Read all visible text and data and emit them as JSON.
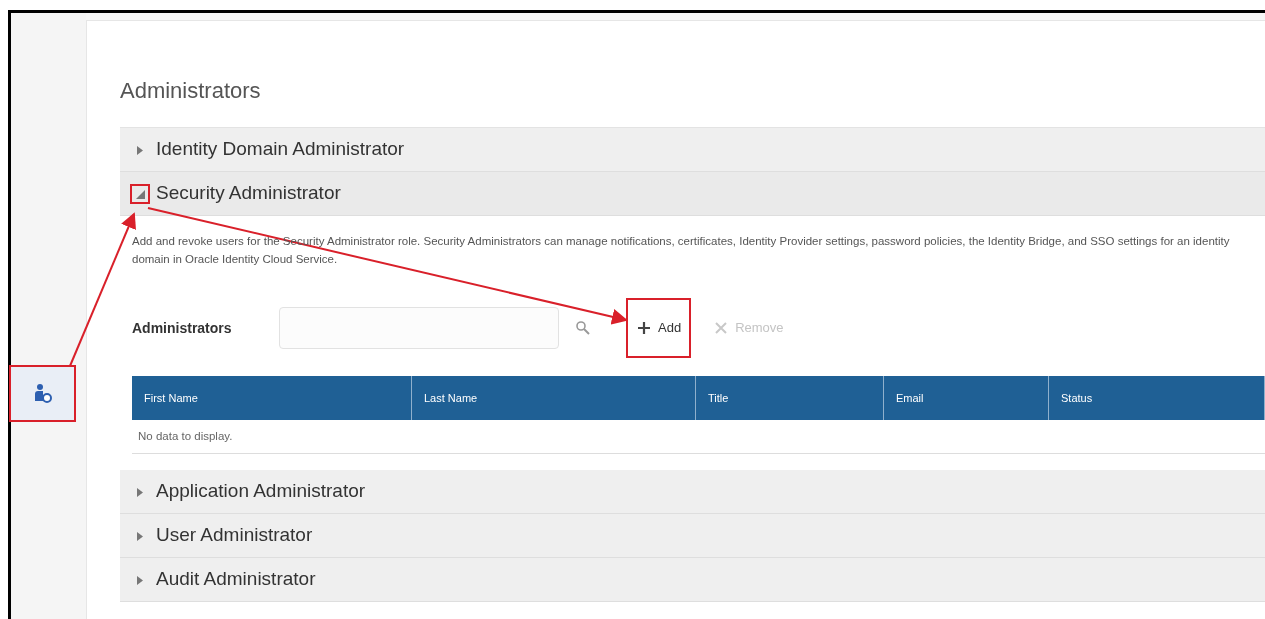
{
  "sidebar": {
    "items": [
      {
        "selected": true,
        "highlighted": true
      }
    ]
  },
  "page_title": "Administrators",
  "sections": [
    {
      "title": "Identity Domain Administrator",
      "expanded": false
    },
    {
      "title": "Security Administrator",
      "expanded": true,
      "expander_highlighted": true,
      "description": "Add and revoke users for the Security Administrator role. Security Administrators can manage notifications, certificates, Identity Provider settings, password policies, the Identity Bridge, and SSO settings for an identity domain in Oracle Identity Cloud Service.",
      "toolbar": {
        "label": "Administrators",
        "buttons": [
          {
            "kind": "add",
            "label": "Add",
            "disabled": false,
            "highlighted": true
          },
          {
            "kind": "remove",
            "label": "Remove",
            "disabled": true,
            "highlighted": false
          }
        ]
      },
      "table": {
        "columns": [
          "First Name",
          "Last Name",
          "Title",
          "Email",
          "Status"
        ],
        "empty_text": "No data to display."
      }
    },
    {
      "title": "Application Administrator",
      "expanded": false
    },
    {
      "title": "User Administrator",
      "expanded": false
    },
    {
      "title": "Audit Administrator",
      "expanded": false
    }
  ]
}
